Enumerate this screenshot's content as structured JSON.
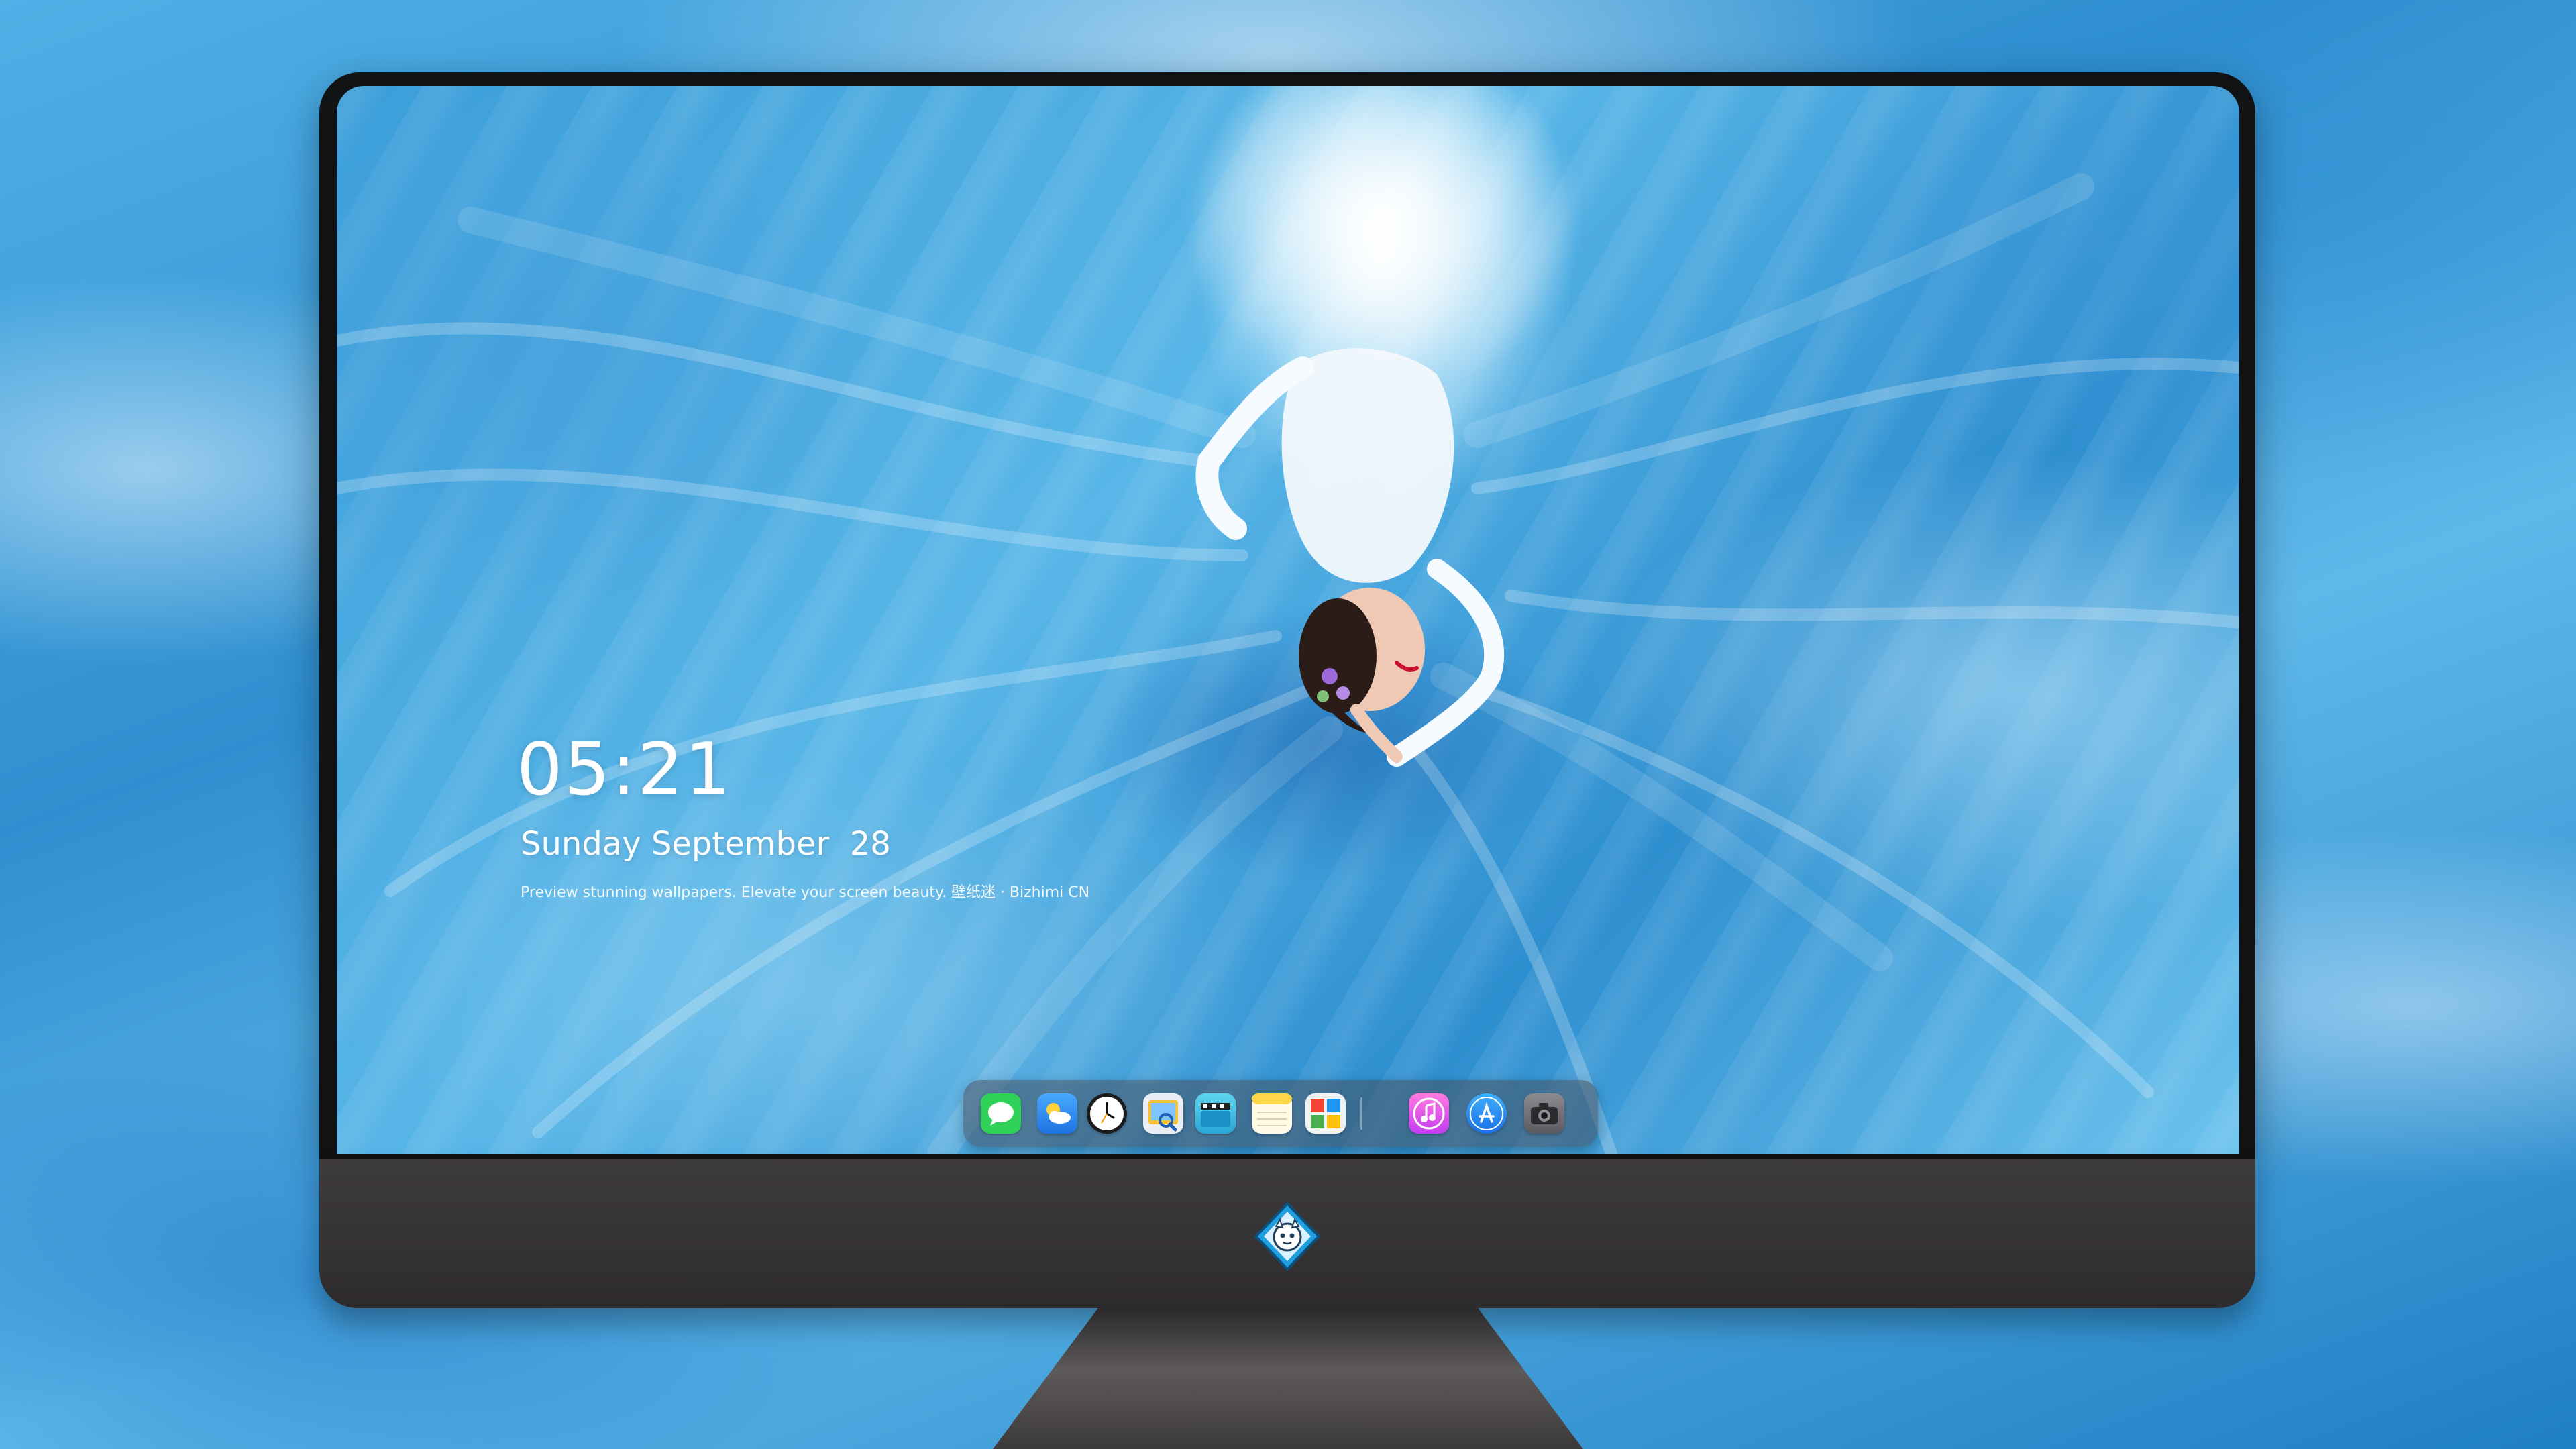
{
  "lock_screen": {
    "time": "05:21",
    "date": "Sunday September  28",
    "tagline": "Preview stunning wallpapers. Elevate your screen beauty. 壁纸迷 · Bizhimi CN"
  },
  "dock": {
    "items": [
      {
        "name": "messages-icon",
        "color": "#2fd158"
      },
      {
        "name": "weather-icon",
        "color": "#3a9af5"
      },
      {
        "name": "clock-icon",
        "color": "#ffffff"
      },
      {
        "name": "preview-icon",
        "color": "#f3c23a"
      },
      {
        "name": "final-cut-icon",
        "color": "#45c6e6"
      },
      {
        "name": "notes-icon",
        "color": "#ffd54a"
      },
      {
        "name": "photo-booth-icon",
        "color": "#4caf50"
      },
      {
        "name": "music-icon",
        "color": "#fc5bd1"
      },
      {
        "name": "app-store-icon",
        "color": "#1e8ef7"
      },
      {
        "name": "camera-icon",
        "color": "#6e6e73"
      }
    ]
  },
  "colors": {
    "monitor_bezel": "#111214",
    "monitor_chin": "#3a3738",
    "dock_background": "#465060"
  }
}
